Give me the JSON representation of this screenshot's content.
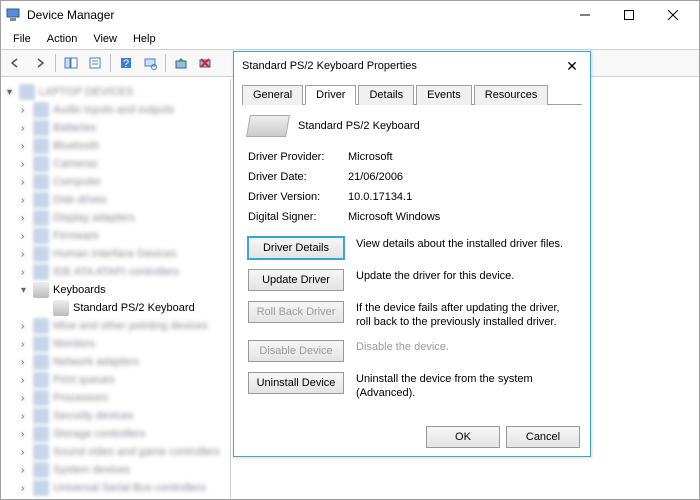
{
  "window": {
    "title": "Device Manager"
  },
  "menu": [
    "File",
    "Action",
    "View",
    "Help"
  ],
  "tree": {
    "keyboards_label": "Keyboards",
    "kbd_device": "Standard PS/2 Keyboard"
  },
  "dialog": {
    "title": "Standard PS/2 Keyboard Properties",
    "tabs": {
      "general": "General",
      "driver": "Driver",
      "details": "Details",
      "events": "Events",
      "resources": "Resources"
    },
    "device_name": "Standard PS/2 Keyboard",
    "rows": {
      "provider_label": "Driver Provider:",
      "provider_value": "Microsoft",
      "date_label": "Driver Date:",
      "date_value": "21/06/2006",
      "version_label": "Driver Version:",
      "version_value": "10.0.17134.1",
      "signer_label": "Digital Signer:",
      "signer_value": "Microsoft Windows"
    },
    "buttons": {
      "details": "Driver Details",
      "details_desc": "View details about the installed driver files.",
      "update": "Update Driver",
      "update_desc": "Update the driver for this device.",
      "rollback": "Roll Back Driver",
      "rollback_desc": "If the device fails after updating the driver, roll back to the previously installed driver.",
      "disable": "Disable Device",
      "disable_desc": "Disable the device.",
      "uninstall": "Uninstall Device",
      "uninstall_desc": "Uninstall the device from the system (Advanced)."
    },
    "footer": {
      "ok": "OK",
      "cancel": "Cancel"
    }
  }
}
